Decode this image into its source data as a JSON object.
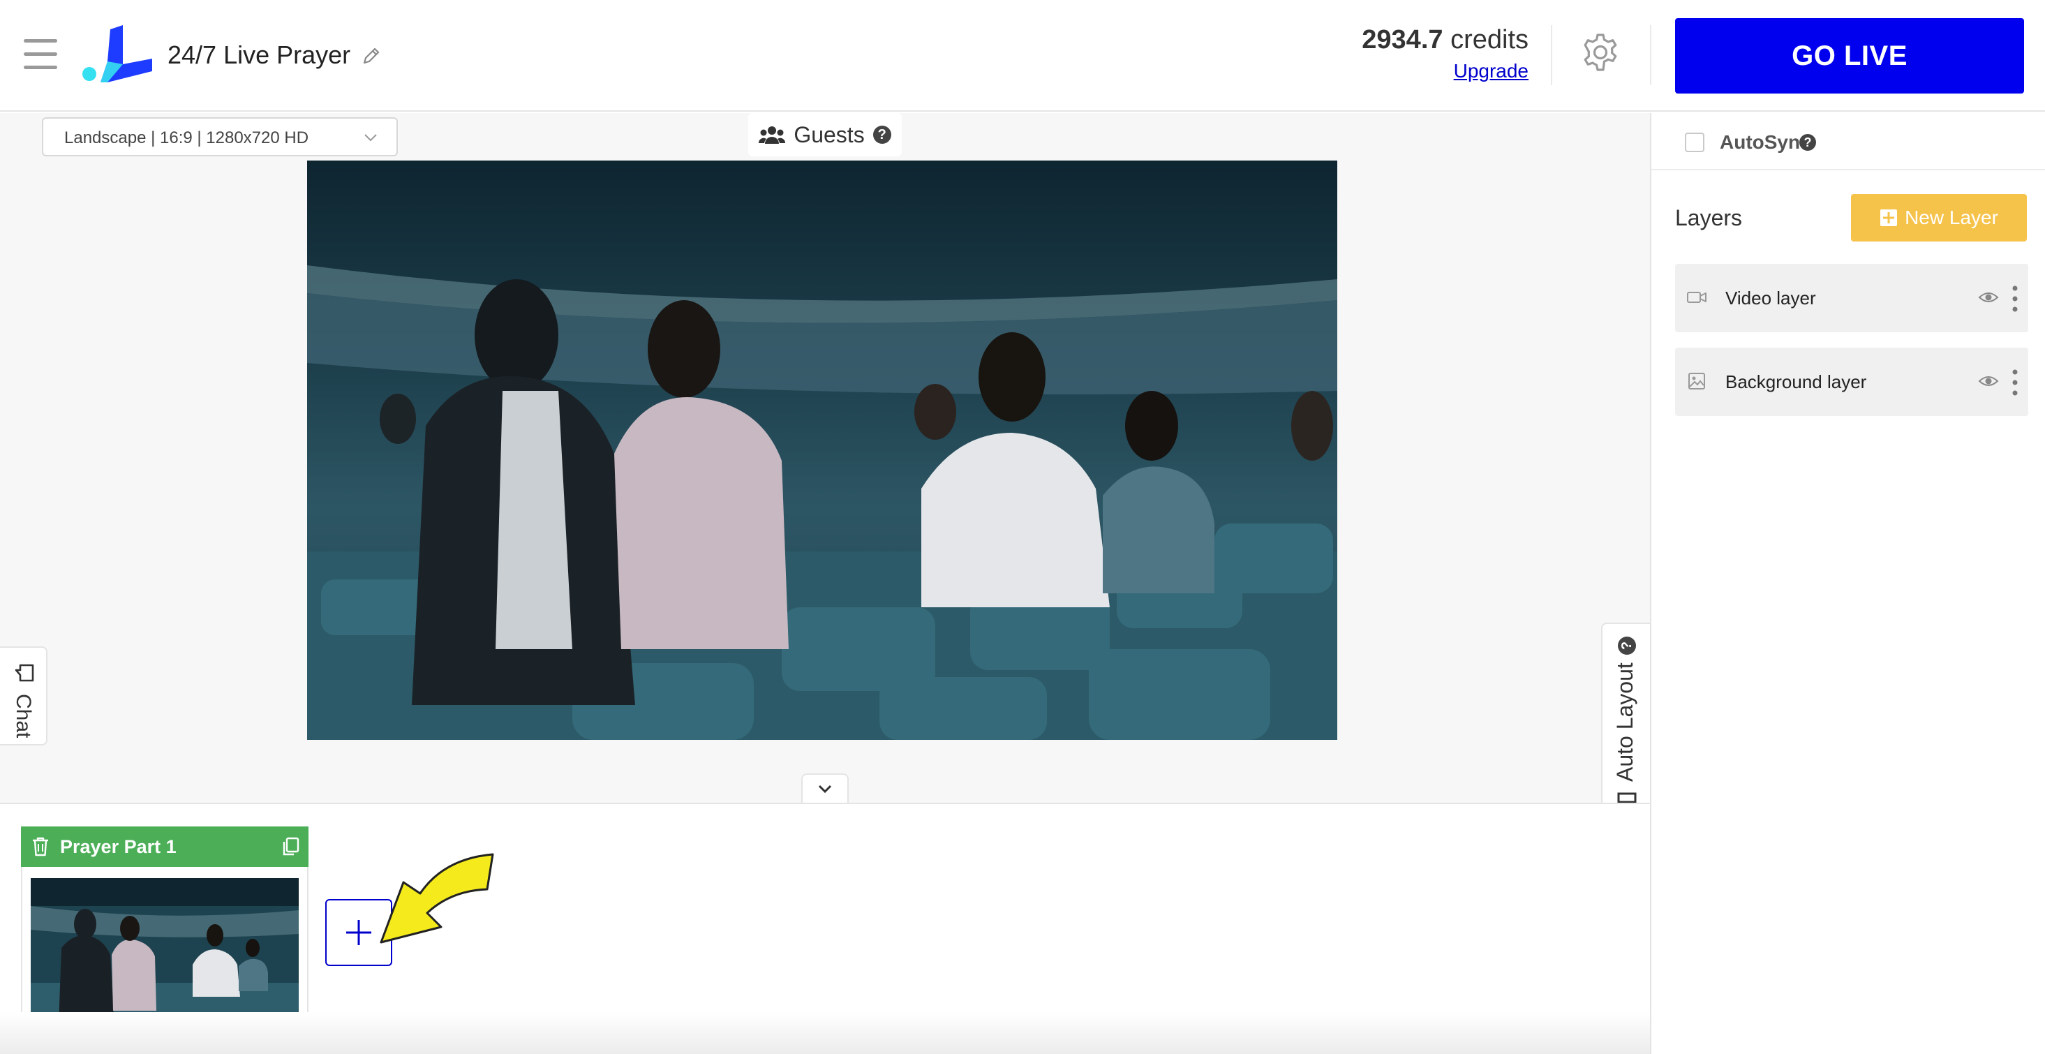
{
  "header": {
    "title": "24/7 Live Prayer",
    "credits_value": "2934.7",
    "credits_unit": "credits",
    "upgrade_label": "Upgrade",
    "go_live_label": "GO LIVE"
  },
  "canvas": {
    "format_selected": "Landscape | 16:9 | 1280x720 HD",
    "guests_label": "Guests",
    "chat_label": "Chat",
    "auto_layout_label": "Auto Layout"
  },
  "scenes": {
    "items": [
      {
        "name": "Prayer Part 1"
      }
    ],
    "add_label": "+"
  },
  "right_panel": {
    "autosync_label": "AutoSync",
    "layers_title": "Layers",
    "new_layer_label": "New Layer",
    "layers": [
      {
        "name": "Video layer",
        "icon": "video-camera-icon"
      },
      {
        "name": "Background layer",
        "icon": "image-icon"
      }
    ]
  },
  "colors": {
    "go_live": "#0000ee",
    "new_layer": "#f5c24a",
    "scene_header": "#4caf58",
    "logo_blue": "#1e3cff",
    "logo_cyan": "#35e0f0"
  }
}
